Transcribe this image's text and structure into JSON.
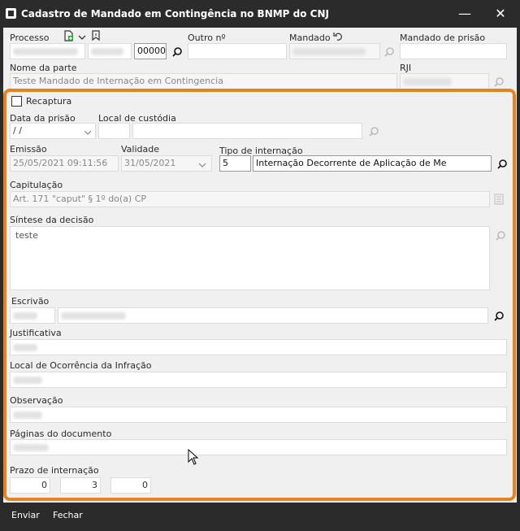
{
  "window": {
    "title": "Cadastro de Mandado em Contingência no BNMP do CNJ"
  },
  "header": {
    "processo_label": "Processo",
    "processo_number": "00000",
    "outro_label": "Outro nº",
    "mandado_label": "Mandado",
    "mandado_prisao_label": "Mandado de prisão",
    "nome_parte_label": "Nome da parte",
    "nome_parte_value": "Teste Mandado de Internação em Contingencia",
    "rji_label": "RJI"
  },
  "main": {
    "recaptura_label": "Recaptura",
    "data_prisao_label": "Data da prisão",
    "data_prisao_value": " /  /",
    "local_custodia_label": "Local de custódia",
    "emissao_label": "Emissão",
    "emissao_value": "25/05/2021 09:11:56",
    "validade_label": "Validade",
    "validade_value": "31/05/2021",
    "tipo_internacao_label": "Tipo de internação",
    "tipo_internacao_code": "5",
    "tipo_internacao_desc": "Internação Decorrente de Aplicação de Me",
    "capitulacao_label": "Capitulação",
    "capitulacao_value": "Art. 171 \"caput\" § 1º do(a) CP",
    "sintese_label": "Síntese da decisão",
    "sintese_value": "teste",
    "escrivao_label": "Escrivão",
    "justificativa_label": "Justificativa",
    "local_ocorrencia_label": "Local de Ocorrência da Infração",
    "observacao_label": "Observação",
    "paginas_label": "Páginas do documento",
    "prazo_label": "Prazo de internação",
    "prazo_values": [
      "0",
      "3",
      "0"
    ]
  },
  "footer": {
    "enviar_label": "Enviar",
    "fechar_label": "Fechar"
  },
  "colors": {
    "accent": "#e8821e",
    "titlebar": "#2b2b2b"
  },
  "icons": [
    "search-icon",
    "document-add-icon",
    "chevron-down-icon",
    "bookmark-icon",
    "undo-icon",
    "list-icon",
    "close-icon",
    "minimize-icon"
  ]
}
